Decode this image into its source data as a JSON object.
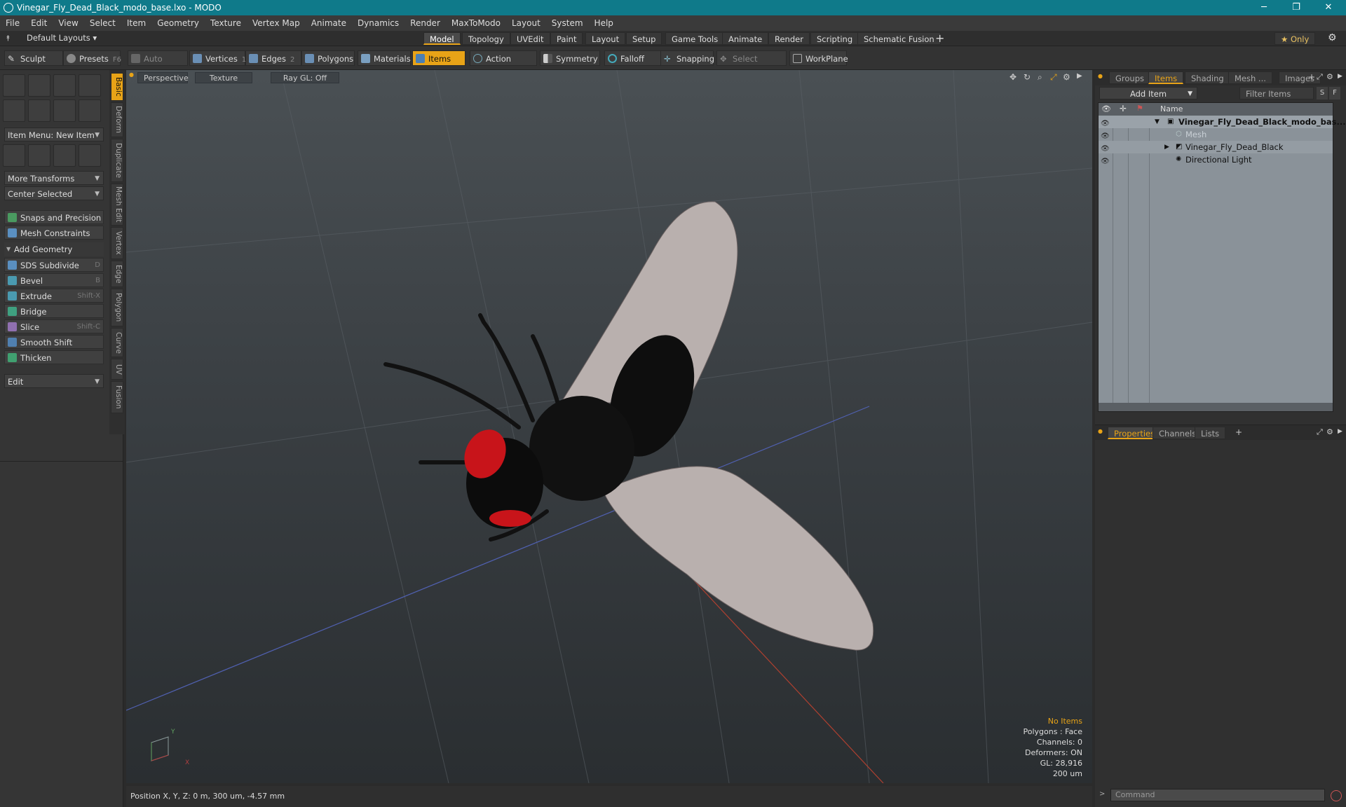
{
  "window": {
    "title": "Vinegar_Fly_Dead_Black_modo_base.lxo - MODO",
    "minimize": "─",
    "maximize": "❐",
    "close": "✕"
  },
  "menu": [
    "File",
    "Edit",
    "View",
    "Select",
    "Item",
    "Geometry",
    "Texture",
    "Vertex Map",
    "Animate",
    "Dynamics",
    "Render",
    "MaxToModo",
    "Layout",
    "System",
    "Help"
  ],
  "layoutbar": {
    "default_layouts": "Default Layouts ▾",
    "tabs": [
      "Model",
      "Topology",
      "UVEdit",
      "Paint",
      "Layout",
      "Setup",
      "Game Tools",
      "Animate",
      "Render",
      "Scripting",
      "Schematic Fusion"
    ],
    "active_tab": "Model",
    "add": "+",
    "only": "★  Only"
  },
  "toolbar": {
    "sculpt": "Sculpt",
    "presets": "Presets",
    "presets_key": "F6",
    "auto_select": "Auto Select",
    "vertices": "Vertices",
    "vertices_key": "1",
    "edges": "Edges",
    "edges_key": "2",
    "polygons": "Polygons",
    "materials": "Materials",
    "items": "Items",
    "action_center": "Action Center",
    "symmetry": "Symmetry",
    "falloff": "Falloff",
    "snapping": "Snapping",
    "select_through": "Select Through",
    "workplane": "WorkPlane"
  },
  "leftpanel": {
    "item_menu": "Item Menu: New Item",
    "more_transforms": "More Transforms",
    "center_selected": "Center Selected",
    "snaps": "Snaps and Precision",
    "mesh_constraints": "Mesh Constraints",
    "add_geometry": "Add Geometry",
    "tools": [
      {
        "label": "SDS Subdivide",
        "key": "D",
        "color": "#5a8fc0"
      },
      {
        "label": "Bevel",
        "key": "B",
        "color": "#4a9ab0"
      },
      {
        "label": "Extrude",
        "key": "Shift-X",
        "color": "#4a9ab0"
      },
      {
        "label": "Bridge",
        "key": "",
        "color": "#3fa080"
      },
      {
        "label": "Slice",
        "key": "Shift-C",
        "color": "#9070b0"
      },
      {
        "label": "Smooth Shift",
        "key": "",
        "color": "#5080b0"
      },
      {
        "label": "Thicken",
        "key": "",
        "color": "#40a070"
      }
    ],
    "edit": "Edit",
    "vtabs": [
      "Basic",
      "Deform",
      "Duplicate",
      "Mesh Edit",
      "Vertex",
      "Edge",
      "Polygon",
      "Curve",
      "UV",
      "Fusion"
    ]
  },
  "viewport": {
    "perspective": "Perspective",
    "texture": "Texture",
    "raygl": "Ray GL: Off",
    "info": {
      "selection": "No Items",
      "polygons": "Polygons : Face",
      "channels": "Channels: 0",
      "deformers": "Deformers: ON",
      "gl": "GL: 28,916",
      "scale": "200 um"
    },
    "axis_x": "X",
    "axis_y": "Y"
  },
  "status": {
    "position": "Position X, Y, Z:   0 m, 300 um, -4.57 mm"
  },
  "rightpanel": {
    "tabs": [
      "Groups",
      "Items",
      "Shading",
      "Mesh ...",
      "Images"
    ],
    "active_tab": "Items",
    "add_item": "Add Item",
    "filter_items": "Filter Items",
    "s_btn": "S",
    "f_btn": "F",
    "name_header": "Name",
    "items": [
      {
        "label": "Vinegar_Fly_Dead_Black_modo_bas...",
        "bold": true,
        "indent": 0
      },
      {
        "label": "Mesh",
        "bold": false,
        "indent": 1,
        "dim": true
      },
      {
        "label": "Vinegar_Fly_Dead_Black",
        "bold": false,
        "indent": 1
      },
      {
        "label": "Directional Light",
        "bold": false,
        "indent": 1
      }
    ],
    "prop_tabs": [
      "Properties",
      "Channels",
      "Lists"
    ],
    "prop_active": "Properties",
    "prop_add": "+",
    "command_placeholder": "Command"
  },
  "colors": {
    "accent": "#e8a317",
    "titlebar": "#0f7a8a",
    "fly_body": "#111111",
    "fly_eye": "#c8141a",
    "wing": "#b9b0ae"
  }
}
